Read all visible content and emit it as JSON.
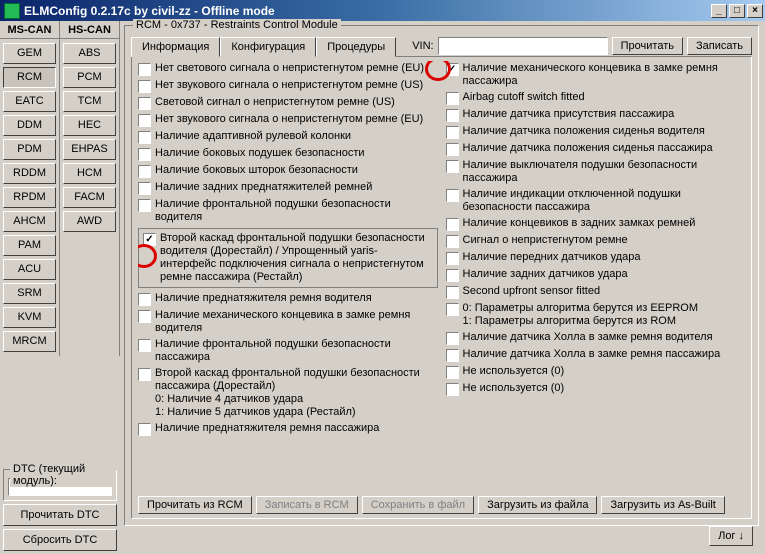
{
  "title": "ELMConfig 0.2.17c by civil-zz - Offline mode",
  "winbtns": {
    "min": "_",
    "max": "□",
    "close": "×"
  },
  "mscan": {
    "head": "MS-CAN",
    "items": [
      "GEM",
      "RCM",
      "EATC",
      "DDM",
      "PDM",
      "RDDM",
      "RPDM",
      "AHCM",
      "PAM",
      "ACU",
      "SRM",
      "KVM",
      "MRCM"
    ]
  },
  "hscan": {
    "head": "HS-CAN",
    "items": [
      "ABS",
      "PCM",
      "TCM",
      "HEC",
      "EHPAS",
      "HCM",
      "FACM",
      "AWD"
    ]
  },
  "group_title": "RCM - 0x737 - Restraints Control Module",
  "tabs": {
    "info": "Информация",
    "config": "Конфигурация",
    "proc": "Процедуры",
    "vin_label": "VIN:",
    "read": "Прочитать",
    "write": "Записать"
  },
  "left_checks": [
    "Нет светового сигнала о непристегнутом ремне (EU)",
    "Нет звукового сигнала о непристегнутом ремне (US)",
    "Световой сигнал о непристегнутом ремне (US)",
    "Нет звукового сигнала о непристегнутом ремне (EU)",
    "Наличие адаптивной рулевой колонки",
    "Наличие боковых подушек безопасности",
    "Наличие боковых шторок безопасности",
    "Наличие задних преднатяжителей ремней",
    "Наличие фронтальной подушки безопасности водителя"
  ],
  "left_boxed": "Второй каскад фронтальной подушки безопасности водителя (Дорестайл) / Упрощенный yaris-интерфейс подключения сигнала о непристегнутом ремне пассажира (Рестайл)",
  "left_checks2": [
    "Наличие преднатяжителя ремня водителя",
    "Наличие механического концевика в замке ремня водителя",
    "Наличие фронтальной подушки безопасности пассажира",
    "Второй каскад фронтальной подушки безопасности пассажира (Дорестайл)\n0: Наличие 4 датчиков удара\n1: Наличие 5 датчиков удара (Рестайл)",
    "Наличие преднатяжителя ремня пассажира"
  ],
  "right_checks": [
    "Наличие механического концевика в замке ремня пассажира",
    "Airbag cutoff switch fitted",
    "Наличие датчика присутствия пассажира",
    "Наличие датчика положения сиденья водителя",
    "Наличие датчика положения сиденья пассажира",
    "Наличие выключателя подушки безопасности пассажира",
    "Наличие индикации отключенной подушки безопасности пассажира",
    "Наличие концевиков в задних замках ремней",
    "Сигнал о непристегнутом ремне",
    "Наличие передних датчиков удара",
    "Наличие задних датчиков удара",
    "Second upfront sensor fitted",
    "0: Параметры алгоритма берутся из EEPROM\n1: Параметры алгоритма берутся из ROM",
    "Наличие датчика Холла в замке ремня водителя",
    "Наличие датчика Холла в замке ремня пассажира",
    "Не используется (0)",
    "Не используется (0)"
  ],
  "bottom_btns": {
    "read_rcm": "Прочитать из RCM",
    "write_rcm": "Записать в RCM",
    "save_file": "Сохранить в файл",
    "load_file": "Загрузить из файла",
    "load_asbuilt": "Загрузить из As-Built"
  },
  "dtc_label": "DTC (текущий модуль):",
  "dtc_btns": {
    "read": "Прочитать DTC",
    "clear": "Сбросить DTC"
  },
  "log_btn": "Лог ↓"
}
